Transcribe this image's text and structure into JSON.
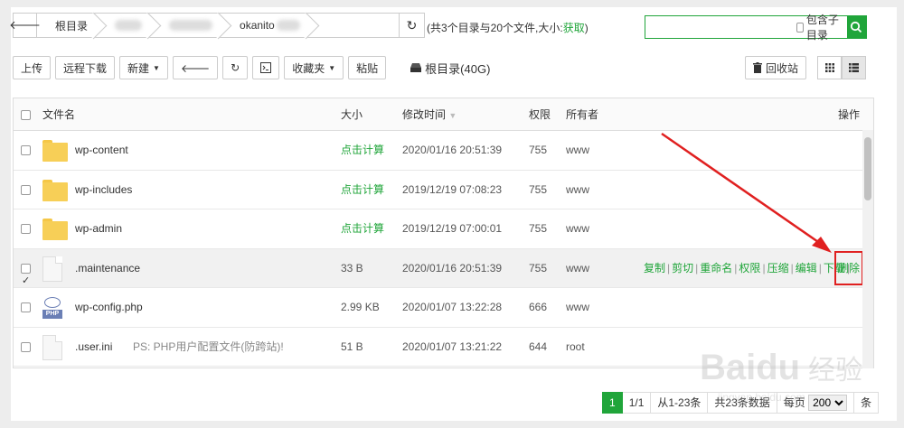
{
  "breadcrumb": {
    "root": "根目录",
    "last": "okanito"
  },
  "summary": {
    "text": "(共3个目录与20个文件,大小:",
    "link": "获取",
    "close": ")"
  },
  "search": {
    "placeholder": "",
    "subdir_label": "包含子目录"
  },
  "toolbar": {
    "upload": "上传",
    "remote_download": "远程下载",
    "new": "新建",
    "terminal_icon": "terminal-icon",
    "favorites": "收藏夹",
    "paste": "粘贴",
    "disk_label": "根目录(40G)",
    "recycle": "回收站"
  },
  "table": {
    "headers": {
      "name": "文件名",
      "size": "大小",
      "mtime": "修改时间",
      "perm": "权限",
      "owner": "所有者",
      "ops": "操作"
    },
    "rows": [
      {
        "type": "folder",
        "name": "wp-content",
        "size": "点击计算",
        "time": "2020/01/16 20:51:39",
        "perm": "755",
        "owner": "www"
      },
      {
        "type": "folder",
        "name": "wp-includes",
        "size": "点击计算",
        "time": "2019/12/19 07:08:23",
        "perm": "755",
        "owner": "www"
      },
      {
        "type": "folder",
        "name": "wp-admin",
        "size": "点击计算",
        "time": "2019/12/19 07:00:01",
        "perm": "755",
        "owner": "www"
      },
      {
        "type": "file",
        "name": ".maintenance",
        "size": "33 B",
        "time": "2020/01/16 20:51:39",
        "perm": "755",
        "owner": "www"
      },
      {
        "type": "php",
        "name": "wp-config.php",
        "size": "2.99 KB",
        "time": "2020/01/07 13:22:28",
        "perm": "666",
        "owner": "www"
      },
      {
        "type": "file",
        "name": ".user.ini",
        "note": "PS: PHP用户配置文件(防跨站)!",
        "size": "51 B",
        "time": "2020/01/07 13:21:22",
        "perm": "644",
        "owner": "root"
      }
    ],
    "ops": [
      "复制",
      "剪切",
      "重命名",
      "权限",
      "压缩",
      "编辑",
      "下载"
    ],
    "delete": "删除"
  },
  "pager": {
    "current": "1",
    "total_pages": "1/1",
    "range": "从1-23条",
    "total": "共23条数据",
    "per_page_label": "每页",
    "per_page": "200",
    "unit": "条"
  },
  "colors": {
    "accent": "#20a53a",
    "annotation": "#e02020"
  }
}
